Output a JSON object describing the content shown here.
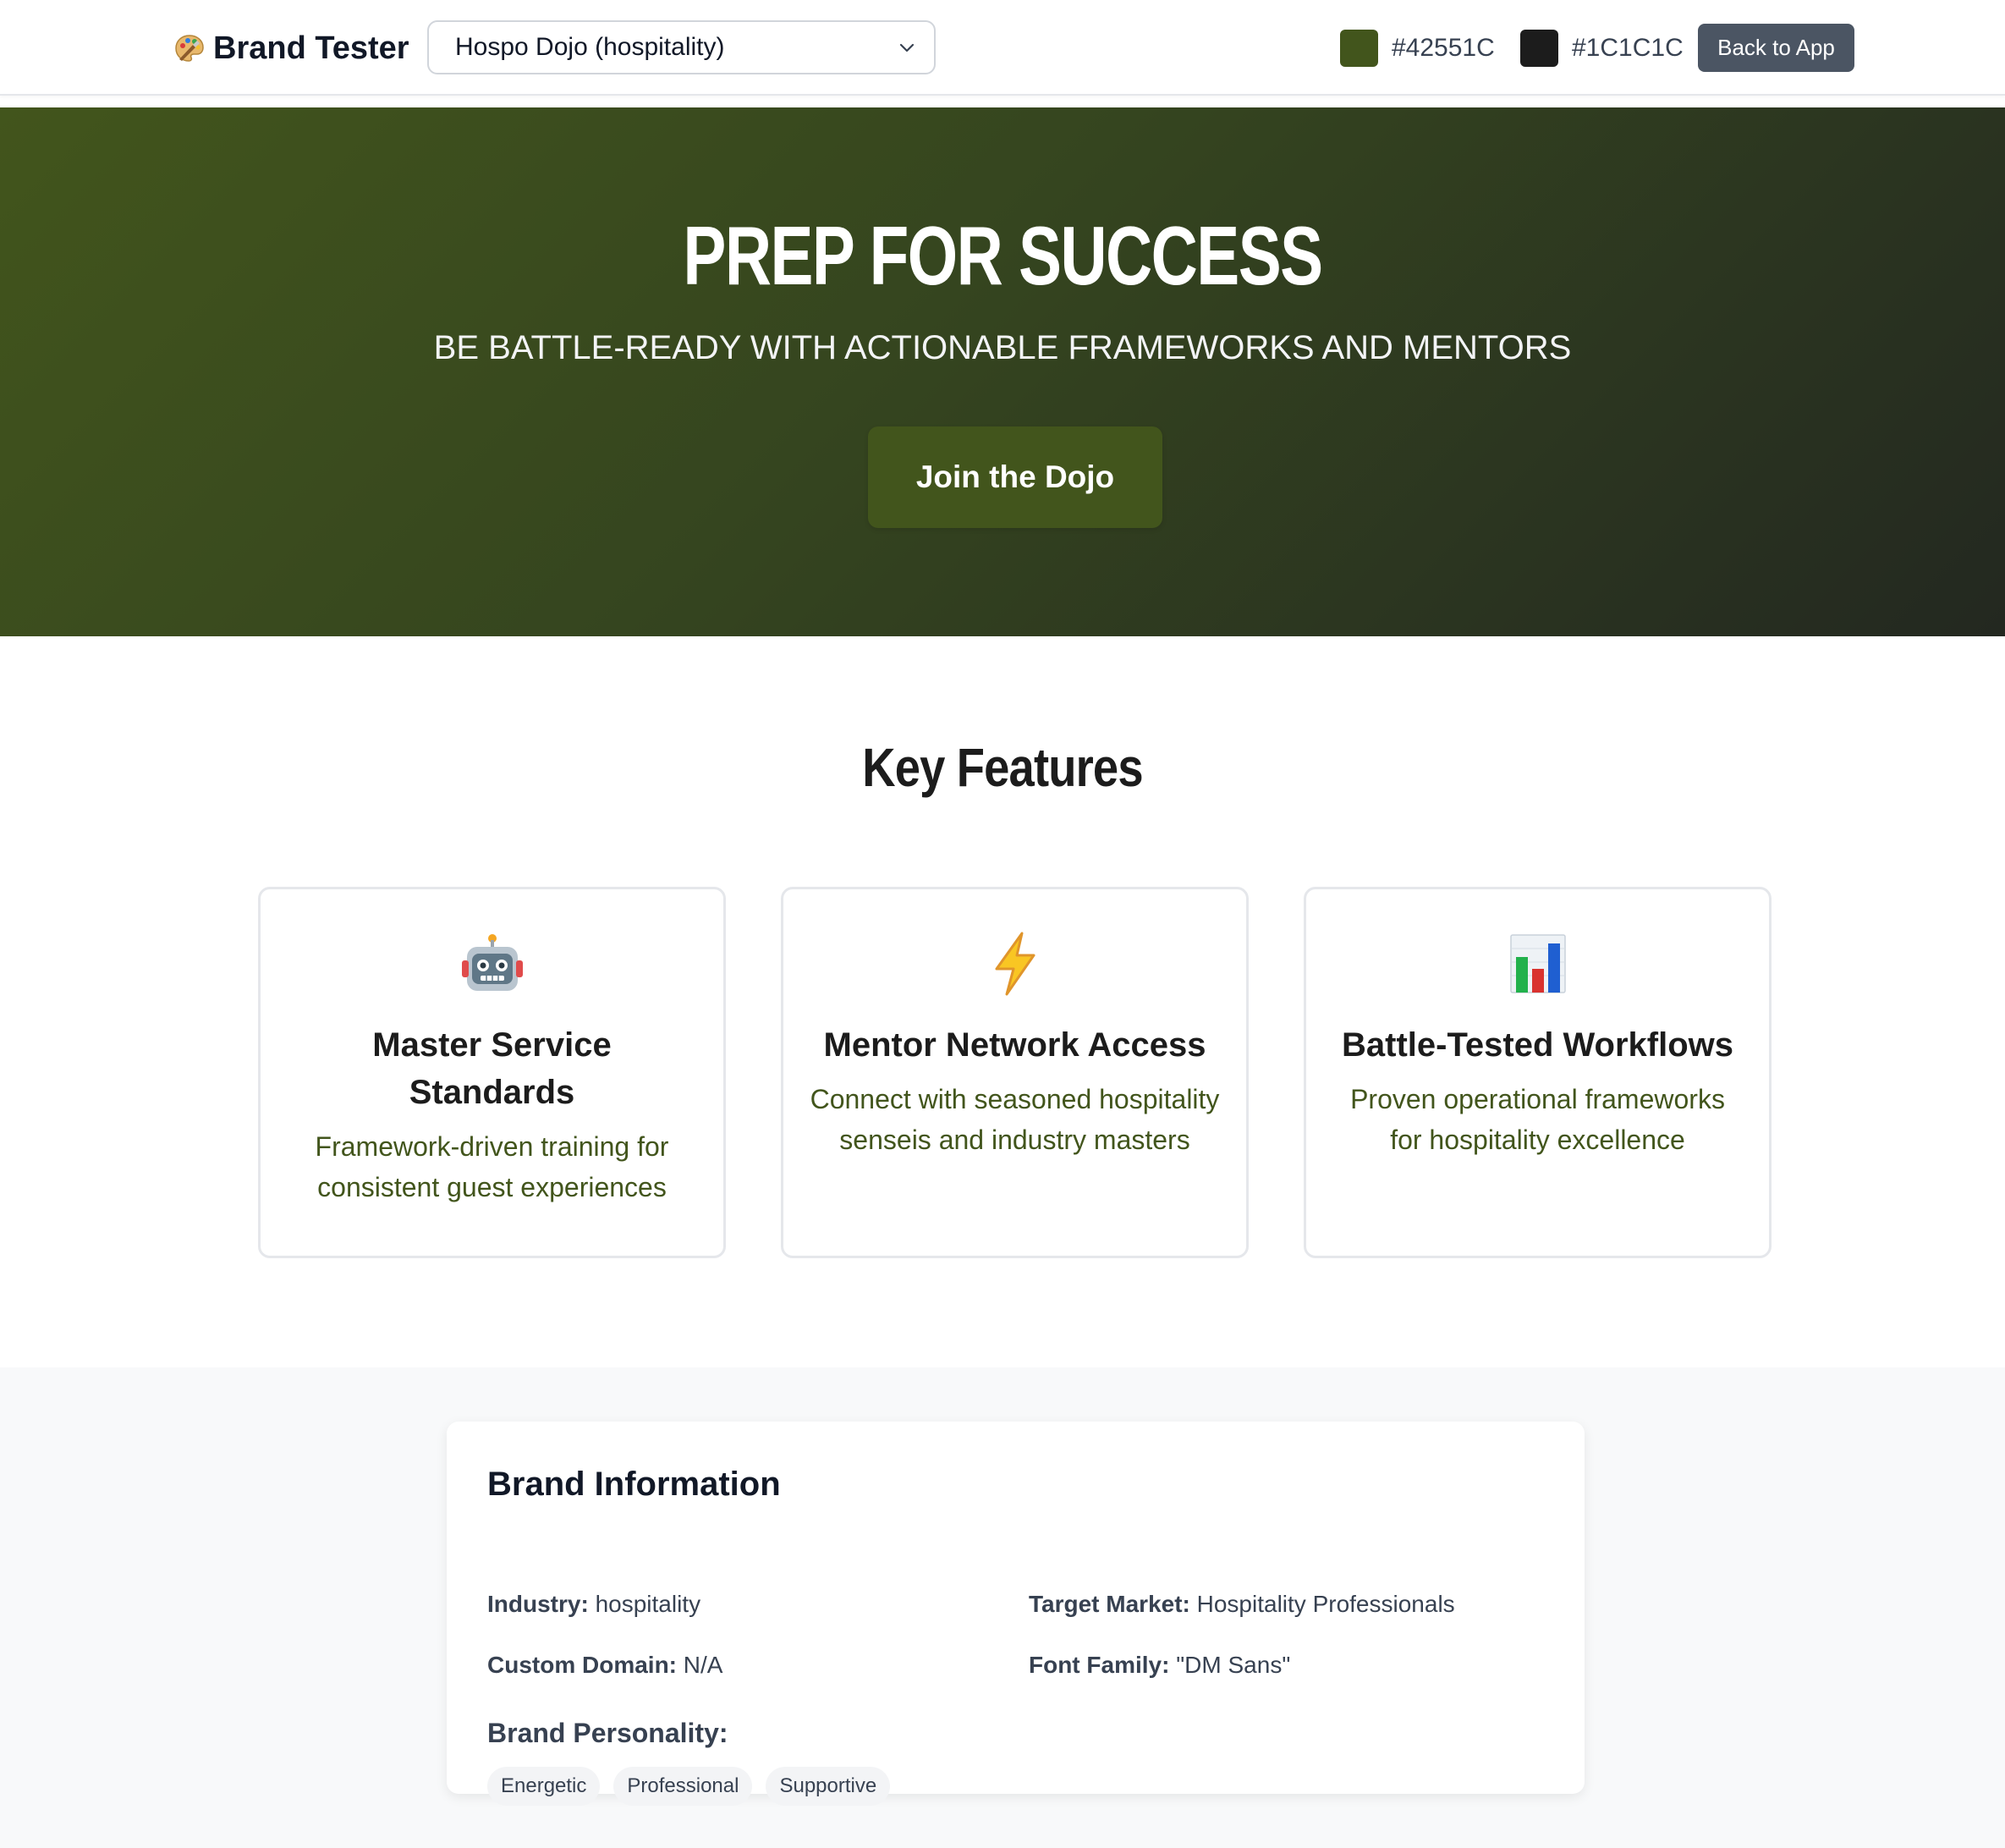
{
  "header": {
    "brand_emoji": "palette-icon",
    "brand_title": "Brand Tester",
    "brand_select": {
      "selected": "Hospo Dojo (hospitality)"
    },
    "primary_color": {
      "hex": "#42551C",
      "label": "#42551C"
    },
    "secondary_color": {
      "hex": "#1C1C1C",
      "label": "#1C1C1C"
    },
    "back_button_label": "Back to App"
  },
  "hero": {
    "title": "PREP FOR SUCCESS",
    "subtitle": "BE BATTLE-READY WITH ACTIONABLE FRAMEWORKS AND MENTORS",
    "cta_label": "Join the Dojo"
  },
  "features": {
    "heading": "Key Features",
    "items": [
      {
        "icon": "robot-icon",
        "title": "Master Service Standards",
        "description": "Framework-driven training for consistent guest experiences"
      },
      {
        "icon": "lightning-icon",
        "title": "Mentor Network Access",
        "description": "Connect with seasoned hospitality senseis and industry masters"
      },
      {
        "icon": "bar-chart-icon",
        "title": "Battle-Tested Workflows",
        "description": "Proven operational frameworks for hospitality excellence"
      }
    ]
  },
  "brand_info": {
    "title": "Brand Information",
    "industry": {
      "label": "Industry:",
      "value": "hospitality"
    },
    "target_market": {
      "label": "Target Market:",
      "value": "Hospitality Professionals"
    },
    "custom_domain": {
      "label": "Custom Domain:",
      "value": "N/A"
    },
    "font_family": {
      "label": "Font Family:",
      "value": "\"DM Sans\""
    },
    "personality_label": "Brand Personality:",
    "personality_tags": [
      "Energetic",
      "Professional",
      "Supportive"
    ]
  },
  "colors": {
    "primary": "#42551C",
    "secondary": "#1C1C1C",
    "button_gray": "#4B5563",
    "section_bg": "#F8F9FA"
  }
}
